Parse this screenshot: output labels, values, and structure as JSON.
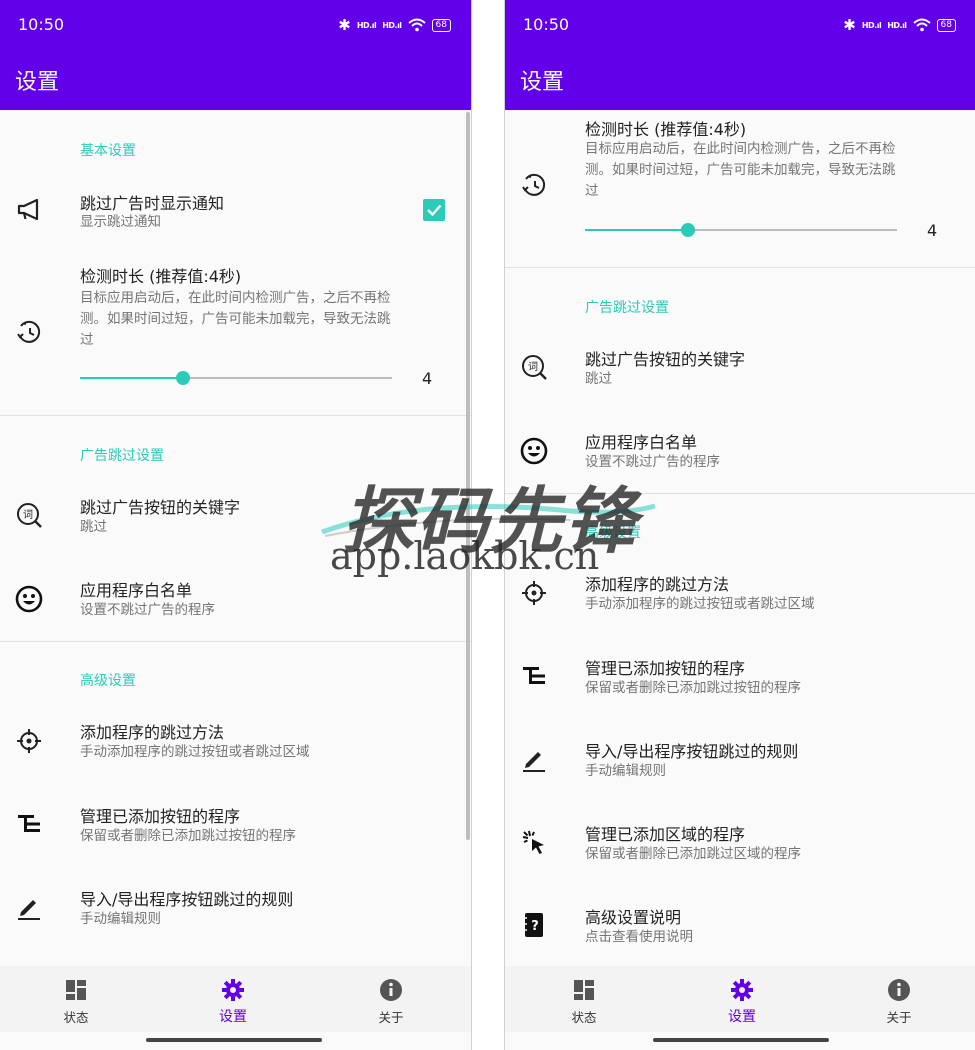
{
  "status_bar": {
    "time": "10:50",
    "bluetooth": "✱",
    "signal_1": "HD.ıl",
    "signal_2": "HD.ıl",
    "battery": "68"
  },
  "app_bar": {
    "title": "设置"
  },
  "sections": {
    "basic": "基本设置",
    "ad_skip": "广告跳过设置",
    "advanced": "高级设置"
  },
  "prefs": {
    "show_notification": {
      "title": "跳过广告时显示通知",
      "summary": "显示跳过通知",
      "checked": true
    },
    "detect_duration": {
      "title": "检测时长 (推荐值:4秒)",
      "summary_line1": "目标应用启动后，在此时间内检测广告，之后不再检",
      "summary_line2": "测。如果时间过短，广告可能未加载完，导致无法跳",
      "summary_line3": "过",
      "value": "4",
      "fraction": 0.33
    },
    "keywords": {
      "title": "跳过广告按钮的关键字",
      "summary": "跳过"
    },
    "whitelist": {
      "title": "应用程序白名单",
      "summary": "设置不跳过广告的程序"
    },
    "add_method": {
      "title": "添加程序的跳过方法",
      "summary": "手动添加程序的跳过按钮或者跳过区域"
    },
    "manage_buttons": {
      "title": "管理已添加按钮的程序",
      "summary": "保留或者删除已添加跳过按钮的程序"
    },
    "import_export": {
      "title": "导入/导出程序按钮跳过的规则",
      "summary": "手动编辑规则"
    },
    "manage_regions": {
      "title": "管理已添加区域的程序",
      "summary": "保留或者删除已添加跳过区域的程序"
    },
    "advanced_help": {
      "title": "高级设置说明",
      "summary": "点击查看使用说明"
    }
  },
  "bottom_nav": {
    "status": "状态",
    "settings": "设置",
    "about": "关于",
    "active": "settings"
  },
  "watermark": {
    "main": "探码先锋",
    "sub": "app.laokbk.cn"
  },
  "colors": {
    "primary": "#6200ea",
    "accent": "#2bcbb8",
    "nav_bg": "#f3f3f3",
    "background": "#fafafa"
  }
}
